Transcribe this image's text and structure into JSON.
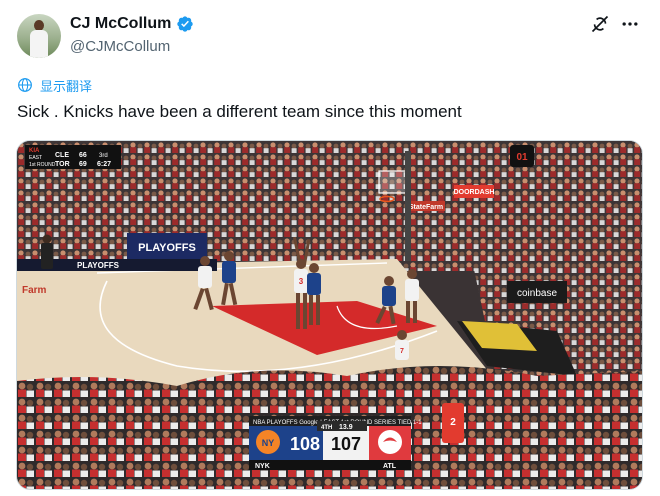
{
  "author": {
    "display_name": "CJ McCollum",
    "handle": "@CJMcCollum",
    "verified": true
  },
  "actions": {
    "grok_icon": "grok-icon",
    "more_icon": "more-icon"
  },
  "translate": {
    "label": "显示翻译",
    "icon": "translate-icon"
  },
  "tweet": {
    "text": "Sick . Knicks have been a different team since this moment"
  },
  "media": {
    "corner_scoreboard": {
      "team1": "CLE",
      "score1": "66",
      "team2": "TOR",
      "score2": "69",
      "quarter": "3rd",
      "clock": "6:27",
      "label1": "EAST",
      "label2": "1st ROUND"
    },
    "shot_clock": "01",
    "sponsor_rtr": "StateFarm",
    "sponsor_doordash": "DOORDASH",
    "sponsor_coinbase": "coinbase",
    "sponsor_pepsi": "PLAYOFFS",
    "court_logo": "PLAYOFFS",
    "baseline_ad": "Farm",
    "jersey_number_1": "3",
    "jersey_number_2": "7",
    "jersey_number_3": "2",
    "scorebug": {
      "banner": "NBA PLAYOFFS Google  |  EAST 1st ROUND SERIES TIED 1-1",
      "home_abbr": "NYK",
      "home_score": "108",
      "away_abbr": "ATL",
      "away_score": "107",
      "period": "4TH",
      "clock": "13.9",
      "home_color": "#1d428a",
      "away_color": "#e03a3e"
    }
  },
  "colors": {
    "accent": "#1d9bf0",
    "text": "#0f1419",
    "muted": "#536471",
    "court_paint": "#d42a2a"
  }
}
